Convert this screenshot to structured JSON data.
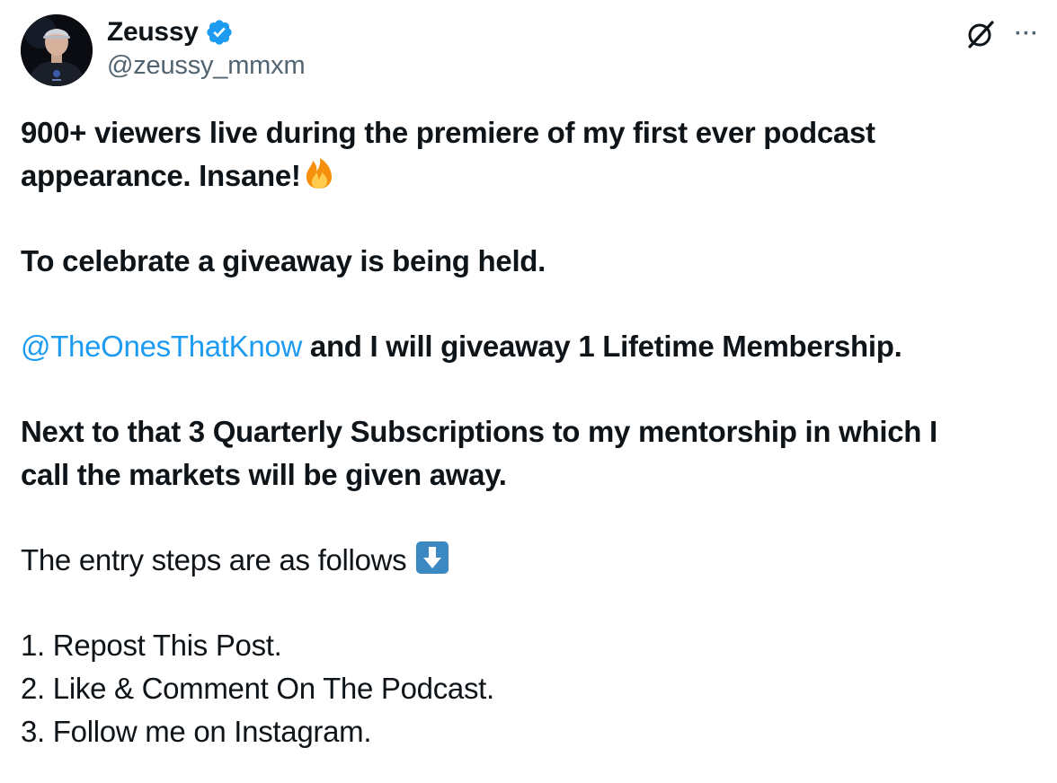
{
  "author": {
    "display_name": "Zeussy",
    "handle": "@zeussy_mmxm",
    "verified": true,
    "avatar": "profile-photo"
  },
  "actions": {
    "grok_icon": "grok-icon",
    "more_icon": "more-options-icon",
    "more_label": "···"
  },
  "post": {
    "line1": "900+ viewers live during the premiere of my first ever podcast",
    "line2": "appearance. Insane!",
    "line2_emoji": "fire-emoji",
    "para2": "To celebrate a giveaway is being held.",
    "mention": "@TheOnesThatKnow",
    "para3_rest": " and I will giveaway 1 Lifetime Membership.",
    "para4_line1": "Next to that 3 Quarterly Subscriptions to my mentorship in which I",
    "para4_line2": "call the markets will be given away.",
    "para5": "The entry steps are as follows ",
    "para5_emoji": "down-arrow-emoji",
    "steps": [
      "1. Repost This Post.",
      "2. Like & Comment On The Podcast.",
      "3. Follow me on Instagram."
    ]
  },
  "colors": {
    "mention": "#1d9bf0",
    "verified_badge": "#1d9bf0",
    "handle_gray": "#536471",
    "text": "#0f1419"
  }
}
